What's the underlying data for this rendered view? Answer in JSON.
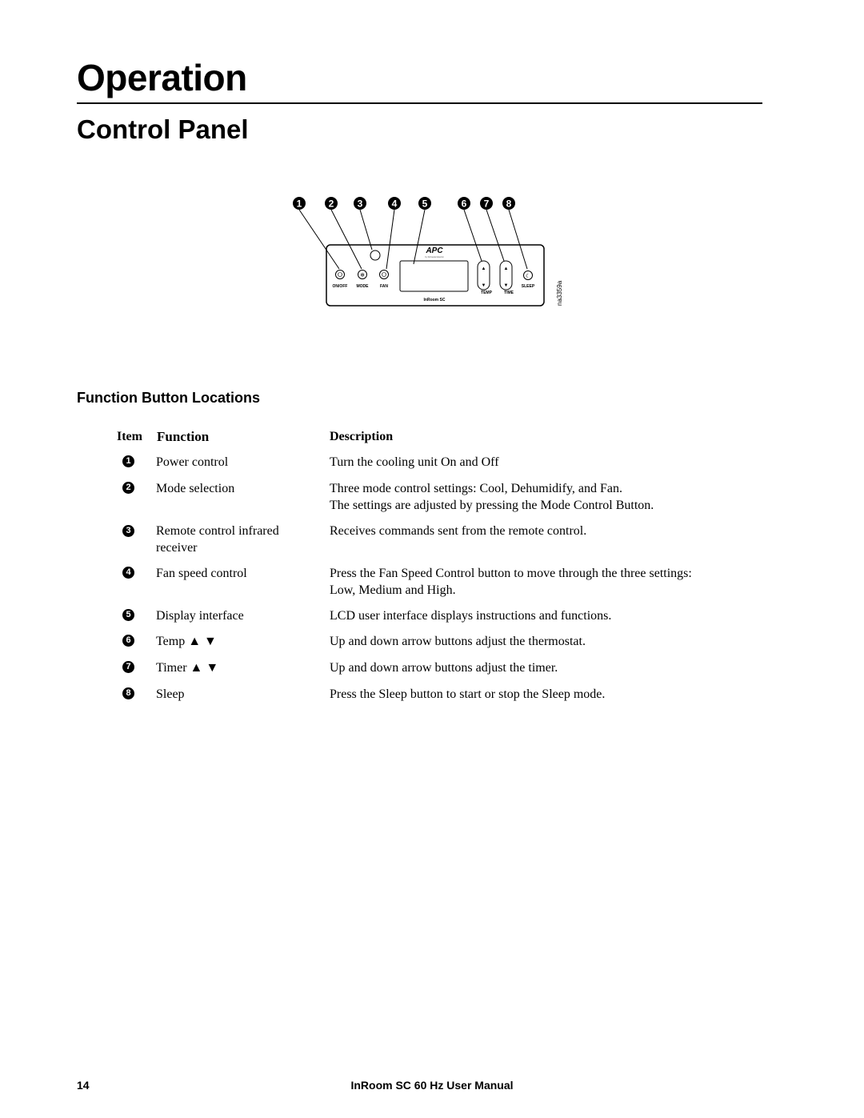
{
  "page": {
    "title": "Operation",
    "section": "Control Panel",
    "subsection": "Function Button Locations",
    "footer_page": "14",
    "footer_title": "InRoom SC 60 Hz User Manual"
  },
  "diagram": {
    "callouts": [
      "1",
      "2",
      "3",
      "4",
      "5",
      "6",
      "7",
      "8"
    ],
    "brand": "APC",
    "brand_sub": "by Schneider Electric",
    "button_labels": [
      "ON/OFF",
      "MODE",
      "FAN",
      "TEMP",
      "TIME",
      "SLEEP"
    ],
    "model": "InRoom SC",
    "figure_id": "na3359a"
  },
  "table": {
    "headers": {
      "item": "Item",
      "function": "Function",
      "description": "Description"
    },
    "rows": [
      {
        "item": "1",
        "function": "Power control",
        "description": "Turn the cooling unit On and Off"
      },
      {
        "item": "2",
        "function": "Mode selection",
        "description": "Three mode control settings: Cool, Dehumidify, and Fan.\nThe settings are adjusted by pressing the Mode Control Button."
      },
      {
        "item": "3",
        "function": "Remote control infrared\nreceiver",
        "description": "Receives commands sent from the remote control."
      },
      {
        "item": "4",
        "function": "Fan speed control",
        "description": "Press the Fan Speed Control button to move through the three settings:\nLow, Medium and High."
      },
      {
        "item": "5",
        "function": "Display interface",
        "description": "LCD user interface displays instructions and functions."
      },
      {
        "item": "6",
        "function": "Temp ▲   ▼",
        "description": "Up and down arrow buttons adjust the thermostat."
      },
      {
        "item": "7",
        "function": "Timer ▲   ▼",
        "description": "Up and down arrow buttons adjust the timer."
      },
      {
        "item": "8",
        "function": " Sleep",
        "description": "Press the Sleep button to start or stop the Sleep mode."
      }
    ]
  }
}
